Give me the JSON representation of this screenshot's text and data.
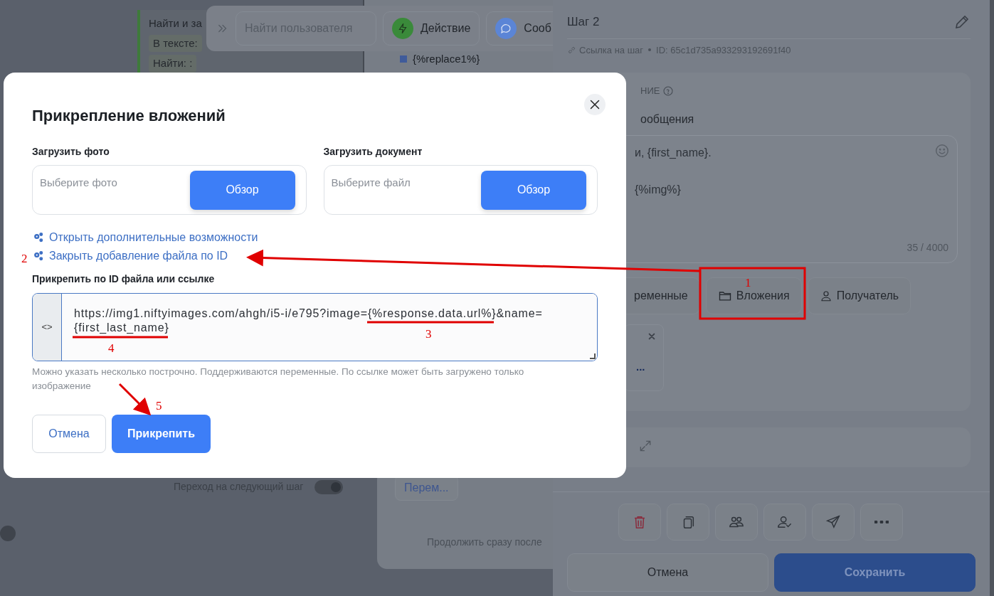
{
  "canvas": {
    "toolbar": {
      "search": {
        "placeholder": "Найти пользователя"
      },
      "buttons": [
        {
          "label": "Действие",
          "kind": "action",
          "color": "#3a8a3a"
        },
        {
          "label": "Сооб",
          "kind": "message",
          "color": "#5b85d6"
        }
      ]
    },
    "find_node": {
      "title": "Найти и за",
      "fields": [
        "В тексте:",
        "Найти: :"
      ]
    },
    "step_node": {
      "variable": "{%replace1%}"
    },
    "transition": {
      "label": "Переход на следующий шаг",
      "on": true
    },
    "next_node": {
      "button": "Перем...",
      "caption": "Продолжить сразу после"
    }
  },
  "panel": {
    "title": "Шаг 2",
    "link": "Ссылка на шаг",
    "id": "ID: 65c1d735a933293192691f40",
    "section": "НИЕ",
    "field_label": "ообщения",
    "message_lines": [
      "и, {first_name}.",
      "{%img%}"
    ],
    "counter": "35 / 4000",
    "buttons": [
      {
        "label": "ременные",
        "kind": "plain"
      },
      {
        "label": "Вложения",
        "kind": "folder"
      },
      {
        "label": "Получатель",
        "kind": "person"
      }
    ],
    "attachment_link": "...",
    "tools": [
      {
        "kind": "trash"
      },
      {
        "kind": "copy"
      },
      {
        "kind": "people"
      },
      {
        "kind": "person-check"
      },
      {
        "kind": "send"
      },
      {
        "kind": "more"
      }
    ],
    "cancel": "Отмена",
    "save": "Сохранить"
  },
  "modal": {
    "title": "Прикрепление вложений",
    "uploads": [
      {
        "label": "Загрузить фото",
        "placeholder": "Выберите фото",
        "button": "Обзор"
      },
      {
        "label": "Загрузить документ",
        "placeholder": "Выберите файл",
        "button": "Обзор"
      }
    ],
    "links": [
      "Открыть дополнительные возможности",
      "Закрыть добавление файла по ID"
    ],
    "url_label": "Прикрепить по ID файла или ссылке",
    "prefix": "<>",
    "url_lines": [
      "https://img1.niftyimages.com/ahgh/i5-i/e795?image={%response.data.url%}&name=",
      "{first_last_name}"
    ],
    "help": "Можно указать несколько построчно. Поддерживаются переменные. По ссылке может быть загружено только изображение",
    "cancel": "Отмена",
    "submit": "Прикрепить"
  },
  "annotations": [
    "1",
    "2",
    "3",
    "4",
    "5"
  ]
}
